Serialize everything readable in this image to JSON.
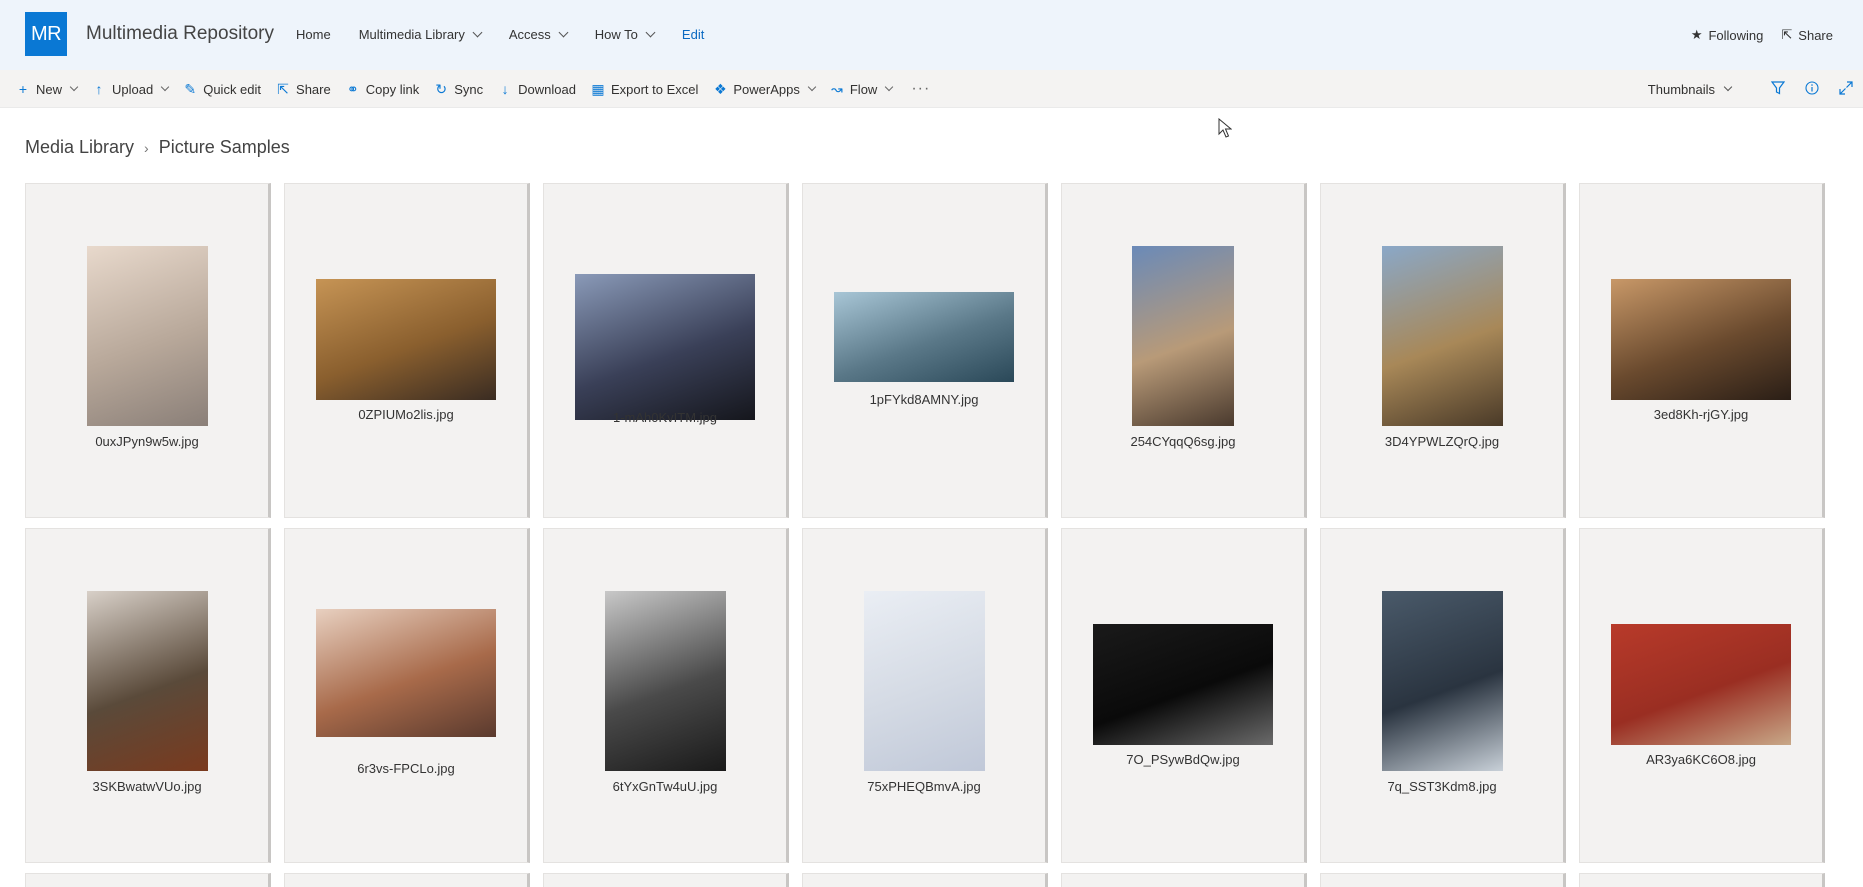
{
  "site": {
    "logo_text": "MR",
    "title": "Multimedia Repository",
    "nav": [
      "Home",
      "Multimedia Library",
      "Access",
      "How To",
      "Edit"
    ],
    "following_label": "Following",
    "share_label": "Share"
  },
  "commands": {
    "new": "New",
    "upload": "Upload",
    "quick_edit": "Quick edit",
    "share": "Share",
    "copy_link": "Copy link",
    "sync": "Sync",
    "download": "Download",
    "export": "Export to Excel",
    "powerapps": "PowerApps",
    "flow": "Flow",
    "more": "···",
    "view": "Thumbnails"
  },
  "breadcrumb": {
    "root": "Media Library",
    "current": "Picture Samples"
  },
  "files": [
    {
      "name": "0uxJPyn9w5w.jpg",
      "orientation": "portrait",
      "colors": [
        "#e8d9cc",
        "#b8a89a",
        "#8a7f78"
      ]
    },
    {
      "name": "0ZPIUMo2lis.jpg",
      "orientation": "landscape",
      "colors": [
        "#c69455",
        "#8a5f2e",
        "#3a2c22"
      ]
    },
    {
      "name": "1-mAh0KvITM.jpg",
      "orientation": "land146",
      "colors": [
        "#8a9ab8",
        "#3a4058",
        "#15161c"
      ]
    },
    {
      "name": "1pFYkd8AMNY.jpg",
      "orientation": "wide",
      "colors": [
        "#a8c6d6",
        "#5a7888",
        "#2a4858"
      ]
    },
    {
      "name": "254CYqqQ6sg.jpg",
      "orientation": "tall2",
      "colors": [
        "#6a8ab8",
        "#b89a78",
        "#4a3a2e"
      ]
    },
    {
      "name": "3D4YPWLZQrQ.jpg",
      "orientation": "portrait",
      "colors": [
        "#8aa8c8",
        "#a88858",
        "#4a3a28"
      ]
    },
    {
      "name": "3ed8Kh-rjGY.jpg",
      "orientation": "landscape",
      "colors": [
        "#c89868",
        "#6a4a2e",
        "#2a1e16"
      ]
    },
    {
      "name": "3SKBwatwVUo.jpg",
      "orientation": "portrait",
      "colors": [
        "#d8d0c8",
        "#5a4a3a",
        "#7a3a1e"
      ]
    },
    {
      "name": "6r3vs-FPCLo.jpg",
      "orientation": "wide2",
      "colors": [
        "#e8d0c0",
        "#a86a4a",
        "#5a3a2e"
      ]
    },
    {
      "name": "6tYxGnTw4uU.jpg",
      "orientation": "portrait",
      "colors": [
        "#c8c8c8",
        "#4a4a4a",
        "#1a1a1a"
      ]
    },
    {
      "name": "75xPHEQBmvA.jpg",
      "orientation": "portrait",
      "colors": [
        "#eaeef4",
        "#d4dae4",
        "#c0c8d8"
      ]
    },
    {
      "name": "7O_PSywBdQw.jpg",
      "orientation": "landscape",
      "colors": [
        "#1a1a1a",
        "#0a0a0a",
        "#6a6a6a"
      ]
    },
    {
      "name": "7q_SST3Kdm8.jpg",
      "orientation": "portrait",
      "colors": [
        "#4a5a6a",
        "#2a3440",
        "#c8d0d8"
      ]
    },
    {
      "name": "AR3ya6KC6O8.jpg",
      "orientation": "landscape",
      "colors": [
        "#b83a2a",
        "#9a2e22",
        "#c8a888"
      ]
    }
  ],
  "theme": {
    "accent": "#0a78d4",
    "header_bg": "#eef4fb",
    "cmdbar_bg": "#f4f3f2"
  }
}
